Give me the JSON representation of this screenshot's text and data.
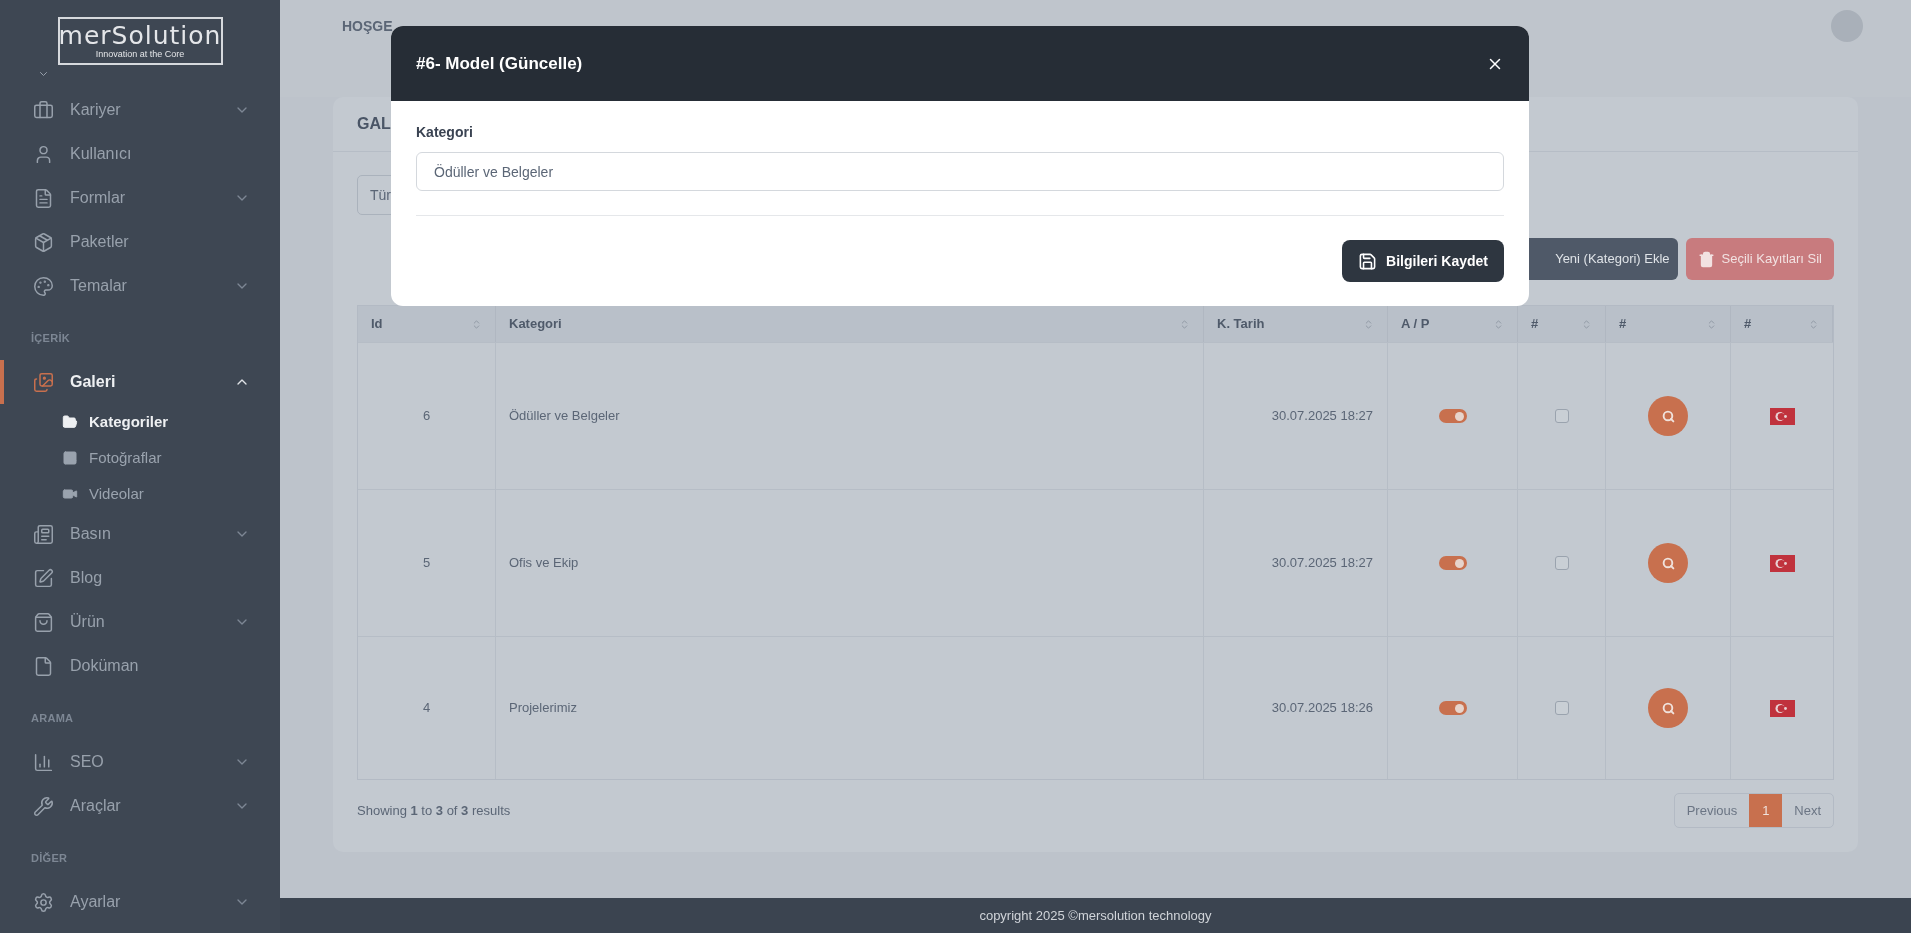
{
  "sidebar": {
    "logo": {
      "title": "merSolution",
      "tagline": "Innovation at the Core"
    },
    "items": [
      {
        "kind": "item",
        "label": "Kariyer",
        "expanded": false,
        "selected": false
      },
      {
        "kind": "item",
        "label": "Kullanıcı",
        "selected": false
      },
      {
        "kind": "item",
        "label": "Formlar",
        "expanded": false,
        "selected": false
      },
      {
        "kind": "item",
        "label": "Paketler",
        "selected": false
      },
      {
        "kind": "item",
        "label": "Temalar",
        "expanded": false,
        "selected": false
      },
      {
        "kind": "section",
        "label": "İÇERİK"
      },
      {
        "kind": "item",
        "label": "Galeri",
        "expanded": true,
        "selected": true
      },
      {
        "kind": "subitem",
        "label": "Kategoriler",
        "selected": true
      },
      {
        "kind": "subitem",
        "label": "Fotoğraflar",
        "selected": false
      },
      {
        "kind": "subitem",
        "label": "Videolar",
        "selected": false
      },
      {
        "kind": "item",
        "label": "Basın",
        "expanded": false,
        "selected": false
      },
      {
        "kind": "item",
        "label": "Blog",
        "selected": false
      },
      {
        "kind": "item",
        "label": "Ürün",
        "expanded": false,
        "selected": false
      },
      {
        "kind": "item",
        "label": "Doküman",
        "selected": false
      },
      {
        "kind": "section",
        "label": "ARAMA"
      },
      {
        "kind": "item",
        "label": "SEO",
        "expanded": false,
        "selected": false
      },
      {
        "kind": "item",
        "label": "Araçlar",
        "expanded": false,
        "selected": false
      },
      {
        "kind": "section",
        "label": "DİĞER"
      },
      {
        "kind": "item",
        "label": "Ayarlar",
        "expanded": false,
        "selected": false
      }
    ]
  },
  "header": {
    "greeting": "HOŞGE"
  },
  "card": {
    "title": "GAL",
    "filter": "Tür",
    "add_button": "Yeni (Kategori) Ekle",
    "delete_button": "Seçili Kayıtları Sil",
    "table": {
      "columns": [
        "Id",
        "Kategori",
        "K. Tarih",
        "A / P",
        "#",
        "#",
        "#"
      ],
      "rows": [
        {
          "id": "6",
          "category": "Ödüller ve Belgeler",
          "date": "30.07.2025 18:27",
          "active": true,
          "checked": false
        },
        {
          "id": "5",
          "category": "Ofis ve Ekip",
          "date": "30.07.2025 18:27",
          "active": true,
          "checked": false
        },
        {
          "id": "4",
          "category": "Projelerimiz",
          "date": "30.07.2025 18:26",
          "active": true,
          "checked": false
        }
      ]
    },
    "summary": "Showing **1** to **3** of **3** results",
    "pagination": {
      "previous": "Previous",
      "pages": [
        {
          "label": "1",
          "selected": true
        }
      ],
      "next": "Next"
    }
  },
  "footer": "copyright 2025 ©mersolution technology",
  "modal": {
    "title": "#6- Model (Güncelle)",
    "field_label": "Kategori",
    "field_value": "Ödüller ve Belgeler",
    "save_button": "Bilgileri Kaydet"
  }
}
